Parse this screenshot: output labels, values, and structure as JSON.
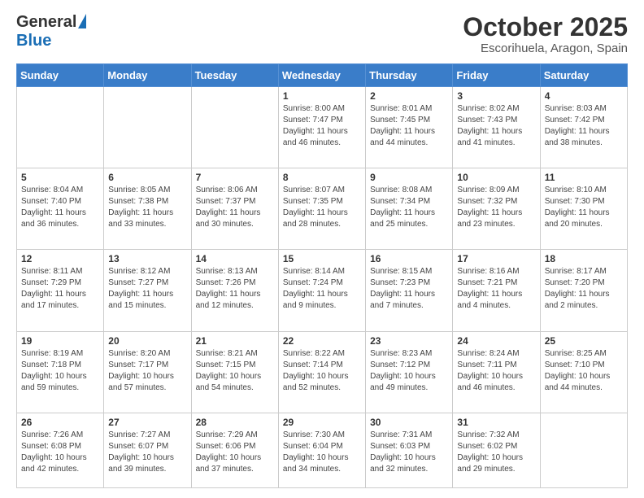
{
  "logo": {
    "line1": "General",
    "line2": "Blue"
  },
  "header": {
    "month": "October 2025",
    "location": "Escorihuela, Aragon, Spain"
  },
  "days_of_week": [
    "Sunday",
    "Monday",
    "Tuesday",
    "Wednesday",
    "Thursday",
    "Friday",
    "Saturday"
  ],
  "weeks": [
    [
      {
        "day": "",
        "info": ""
      },
      {
        "day": "",
        "info": ""
      },
      {
        "day": "",
        "info": ""
      },
      {
        "day": "1",
        "info": "Sunrise: 8:00 AM\nSunset: 7:47 PM\nDaylight: 11 hours and 46 minutes."
      },
      {
        "day": "2",
        "info": "Sunrise: 8:01 AM\nSunset: 7:45 PM\nDaylight: 11 hours and 44 minutes."
      },
      {
        "day": "3",
        "info": "Sunrise: 8:02 AM\nSunset: 7:43 PM\nDaylight: 11 hours and 41 minutes."
      },
      {
        "day": "4",
        "info": "Sunrise: 8:03 AM\nSunset: 7:42 PM\nDaylight: 11 hours and 38 minutes."
      }
    ],
    [
      {
        "day": "5",
        "info": "Sunrise: 8:04 AM\nSunset: 7:40 PM\nDaylight: 11 hours and 36 minutes."
      },
      {
        "day": "6",
        "info": "Sunrise: 8:05 AM\nSunset: 7:38 PM\nDaylight: 11 hours and 33 minutes."
      },
      {
        "day": "7",
        "info": "Sunrise: 8:06 AM\nSunset: 7:37 PM\nDaylight: 11 hours and 30 minutes."
      },
      {
        "day": "8",
        "info": "Sunrise: 8:07 AM\nSunset: 7:35 PM\nDaylight: 11 hours and 28 minutes."
      },
      {
        "day": "9",
        "info": "Sunrise: 8:08 AM\nSunset: 7:34 PM\nDaylight: 11 hours and 25 minutes."
      },
      {
        "day": "10",
        "info": "Sunrise: 8:09 AM\nSunset: 7:32 PM\nDaylight: 11 hours and 23 minutes."
      },
      {
        "day": "11",
        "info": "Sunrise: 8:10 AM\nSunset: 7:30 PM\nDaylight: 11 hours and 20 minutes."
      }
    ],
    [
      {
        "day": "12",
        "info": "Sunrise: 8:11 AM\nSunset: 7:29 PM\nDaylight: 11 hours and 17 minutes."
      },
      {
        "day": "13",
        "info": "Sunrise: 8:12 AM\nSunset: 7:27 PM\nDaylight: 11 hours and 15 minutes."
      },
      {
        "day": "14",
        "info": "Sunrise: 8:13 AM\nSunset: 7:26 PM\nDaylight: 11 hours and 12 minutes."
      },
      {
        "day": "15",
        "info": "Sunrise: 8:14 AM\nSunset: 7:24 PM\nDaylight: 11 hours and 9 minutes."
      },
      {
        "day": "16",
        "info": "Sunrise: 8:15 AM\nSunset: 7:23 PM\nDaylight: 11 hours and 7 minutes."
      },
      {
        "day": "17",
        "info": "Sunrise: 8:16 AM\nSunset: 7:21 PM\nDaylight: 11 hours and 4 minutes."
      },
      {
        "day": "18",
        "info": "Sunrise: 8:17 AM\nSunset: 7:20 PM\nDaylight: 11 hours and 2 minutes."
      }
    ],
    [
      {
        "day": "19",
        "info": "Sunrise: 8:19 AM\nSunset: 7:18 PM\nDaylight: 10 hours and 59 minutes."
      },
      {
        "day": "20",
        "info": "Sunrise: 8:20 AM\nSunset: 7:17 PM\nDaylight: 10 hours and 57 minutes."
      },
      {
        "day": "21",
        "info": "Sunrise: 8:21 AM\nSunset: 7:15 PM\nDaylight: 10 hours and 54 minutes."
      },
      {
        "day": "22",
        "info": "Sunrise: 8:22 AM\nSunset: 7:14 PM\nDaylight: 10 hours and 52 minutes."
      },
      {
        "day": "23",
        "info": "Sunrise: 8:23 AM\nSunset: 7:12 PM\nDaylight: 10 hours and 49 minutes."
      },
      {
        "day": "24",
        "info": "Sunrise: 8:24 AM\nSunset: 7:11 PM\nDaylight: 10 hours and 46 minutes."
      },
      {
        "day": "25",
        "info": "Sunrise: 8:25 AM\nSunset: 7:10 PM\nDaylight: 10 hours and 44 minutes."
      }
    ],
    [
      {
        "day": "26",
        "info": "Sunrise: 7:26 AM\nSunset: 6:08 PM\nDaylight: 10 hours and 42 minutes."
      },
      {
        "day": "27",
        "info": "Sunrise: 7:27 AM\nSunset: 6:07 PM\nDaylight: 10 hours and 39 minutes."
      },
      {
        "day": "28",
        "info": "Sunrise: 7:29 AM\nSunset: 6:06 PM\nDaylight: 10 hours and 37 minutes."
      },
      {
        "day": "29",
        "info": "Sunrise: 7:30 AM\nSunset: 6:04 PM\nDaylight: 10 hours and 34 minutes."
      },
      {
        "day": "30",
        "info": "Sunrise: 7:31 AM\nSunset: 6:03 PM\nDaylight: 10 hours and 32 minutes."
      },
      {
        "day": "31",
        "info": "Sunrise: 7:32 AM\nSunset: 6:02 PM\nDaylight: 10 hours and 29 minutes."
      },
      {
        "day": "",
        "info": ""
      }
    ]
  ]
}
